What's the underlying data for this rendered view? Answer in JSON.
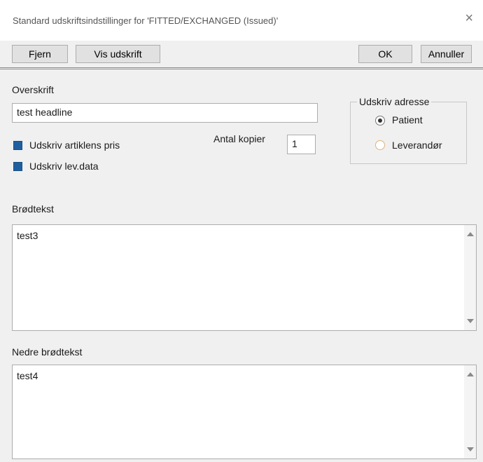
{
  "window": {
    "title": "Standard udskriftsindstillinger for 'FITTED/EXCHANGED (Issued)'",
    "close_icon": "×"
  },
  "toolbar": {
    "remove_label": "Fjern",
    "preview_label": "Vis udskrift",
    "ok_label": "OK",
    "cancel_label": "Annuller"
  },
  "headline": {
    "label": "Overskrift",
    "value": "test headline"
  },
  "options": {
    "print_price_label": "Udskriv artiklens pris",
    "print_price_checked": true,
    "print_supplier_label": "Udskriv lev.data",
    "print_supplier_checked": true
  },
  "copies": {
    "label": "Antal kopier",
    "value": "1"
  },
  "address": {
    "label": "Udskriv adresse",
    "patient_label": "Patient",
    "supplier_label": "Leverandør",
    "selected": "Patient"
  },
  "body_text": {
    "label": "Brødtekst",
    "value": "test3"
  },
  "lower_text": {
    "label": "Nedre brødtekst",
    "value": "test4"
  }
}
